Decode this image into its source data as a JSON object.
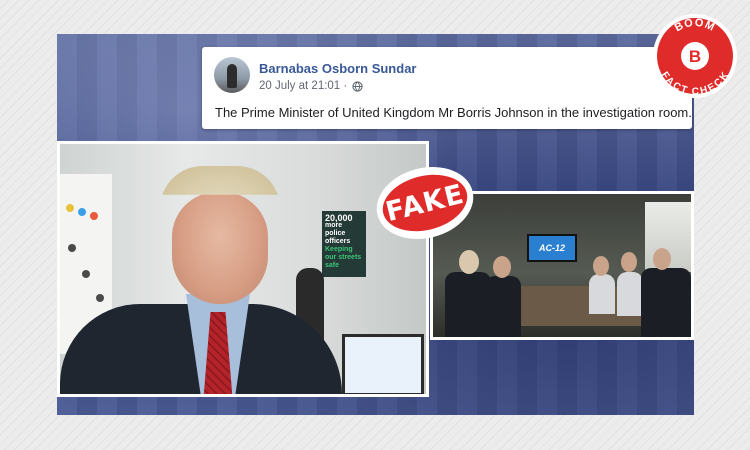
{
  "post": {
    "author": "Barnabas Osborn Sundar",
    "timestamp": "20 July at 21:01 ·",
    "privacy_icon": "globe-icon",
    "text": "The Prime Minister of United Kingdom Mr Borris Johnson in the investigation room."
  },
  "left_photo": {
    "poster_line1": "20,000",
    "poster_line2": "more police",
    "poster_line3": "officers",
    "poster_line4": "Keeping",
    "poster_line5": "our streets",
    "poster_line6": "safe"
  },
  "right_photo": {
    "screen_text": "AC-12"
  },
  "stamp": {
    "label": "FAKE"
  },
  "badge": {
    "top_text": "BOOM",
    "bottom_text": "FACT CHECK",
    "logo_letter": "B"
  },
  "colors": {
    "facebook_name": "#385898",
    "stamp_red": "#e02b2b",
    "badge_red": "#e02b2b"
  }
}
